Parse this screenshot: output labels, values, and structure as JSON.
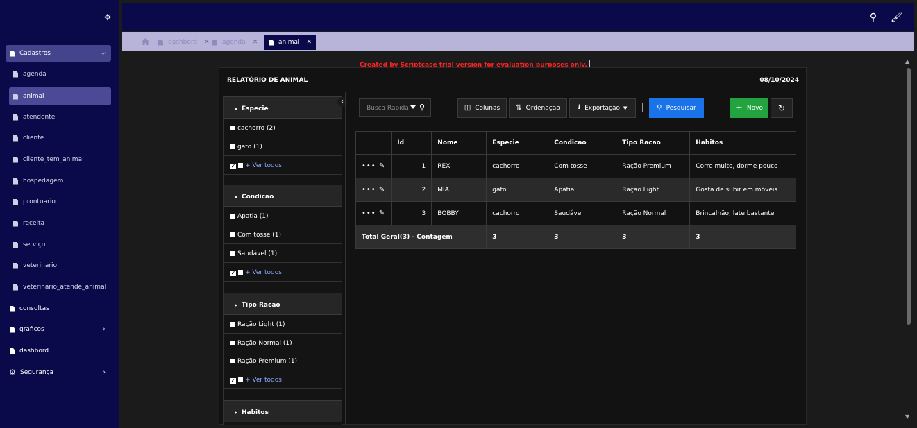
{
  "sidebar": {
    "items": [
      {
        "label": "Cadastros",
        "icon": "doc-icon",
        "open": true
      },
      {
        "label": "agenda",
        "icon": "doc-icon"
      },
      {
        "label": "animal",
        "icon": "doc-icon",
        "active": true
      },
      {
        "label": "atendente",
        "icon": "doc-icon"
      },
      {
        "label": "cliente",
        "icon": "doc-icon"
      },
      {
        "label": "cliente_tem_animal",
        "icon": "doc-icon"
      },
      {
        "label": "hospedagem",
        "icon": "doc-icon"
      },
      {
        "label": "prontuario",
        "icon": "doc-icon"
      },
      {
        "label": "receita",
        "icon": "doc-icon"
      },
      {
        "label": "serviço",
        "icon": "doc-icon"
      },
      {
        "label": "veterinario",
        "icon": "doc-icon"
      },
      {
        "label": "veterinario_atende_animal",
        "icon": "doc-icon"
      },
      {
        "label": "consultas",
        "icon": "doc-icon"
      },
      {
        "label": "graficos",
        "icon": "doc-icon"
      },
      {
        "label": "dashbord",
        "icon": "doc-icon"
      },
      {
        "label": "Segurança",
        "icon": "gear-icon"
      }
    ]
  },
  "tabs": [
    {
      "label": "dashbord"
    },
    {
      "label": "agenda"
    },
    {
      "label": "animal",
      "active": true
    }
  ],
  "trial_notice": "Created by Scriptcase trial version for evaluation purposes only.",
  "report": {
    "title": "RELATÓRIO DE ANIMAL",
    "date": "08/10/2024"
  },
  "filters": {
    "groups": [
      {
        "title": "Especie",
        "options": [
          "cachorro  (2)",
          "gato  (1)"
        ],
        "see_all": "+ Ver todos"
      },
      {
        "title": "Condicao",
        "options": [
          "Apatia  (1)",
          "Com tosse  (1)",
          "Saudável  (1)"
        ],
        "see_all": "+ Ver todos"
      },
      {
        "title": "Tipo Racao",
        "options": [
          "Ração Light  (1)",
          "Ração Normal  (1)",
          "Ração Premium  (1)"
        ],
        "see_all": "+ Ver todos"
      },
      {
        "title": "Habitos"
      }
    ]
  },
  "toolbar": {
    "search_placeholder": "Busca Rapida",
    "colunas": "Colunas",
    "ordenacao": "Ordenação",
    "exportacao": "Exportação",
    "pesquisar": "Pesquisar",
    "novo": "Novo"
  },
  "table": {
    "headers": [
      "Id",
      "Nome",
      "Especie",
      "Condicao",
      "Tipo Racao",
      "Habitos"
    ],
    "rows": [
      [
        "1",
        "REX",
        "cachorro",
        "Com tosse",
        "Ração Premium",
        "Corre muito, dorme pouco"
      ],
      [
        "2",
        "MIA",
        "gato",
        "Apatia",
        "Ração Light",
        "Gosta de subir em móveis"
      ],
      [
        "3",
        "BOBBY",
        "cachorro",
        "Saudável",
        "Ração Normal",
        "Brincalhão, late bastante"
      ]
    ],
    "total": [
      "Total Geral(3) - Contagem",
      "3",
      "3",
      "3",
      "3"
    ]
  }
}
